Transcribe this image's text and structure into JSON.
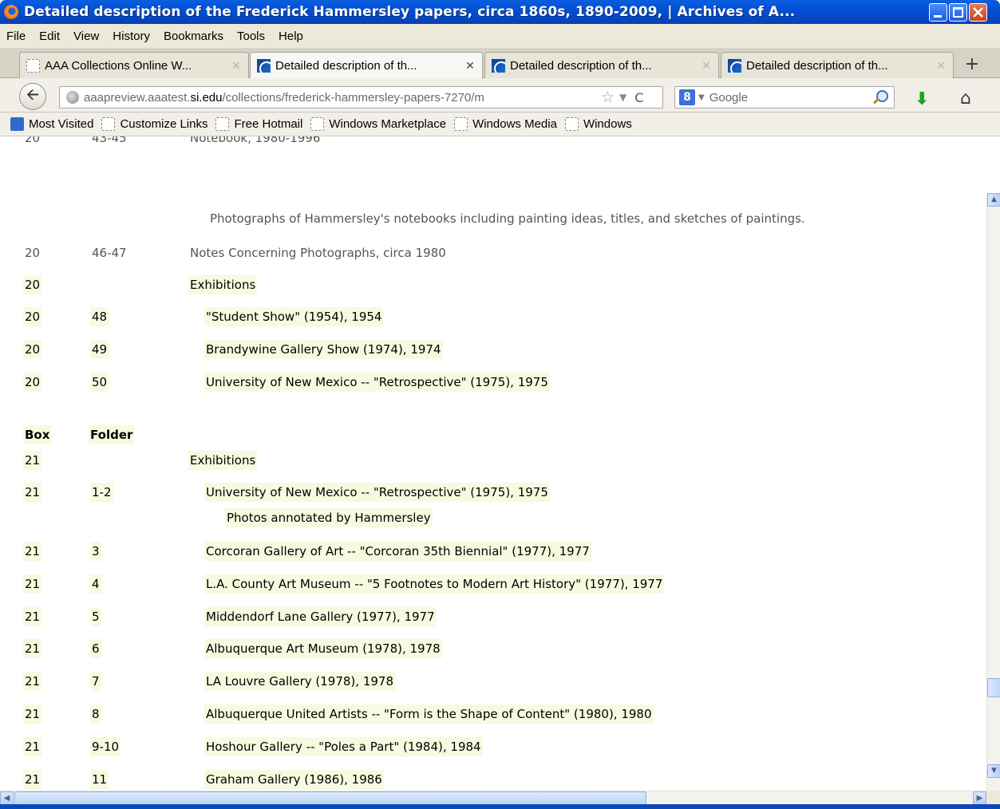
{
  "window": {
    "title": "Detailed description of the Frederick Hammersley papers, circa 1860s, 1890-2009, | Archives of A..."
  },
  "menu": [
    "File",
    "Edit",
    "View",
    "History",
    "Bookmarks",
    "Tools",
    "Help"
  ],
  "tabs": [
    {
      "label": "AAA Collections Online W...",
      "active": false,
      "icon": "blank-page-icon"
    },
    {
      "label": "Detailed description of th...",
      "active": true,
      "icon": "aaa-favicon"
    },
    {
      "label": "Detailed description of th...",
      "active": false,
      "icon": "aaa-favicon"
    },
    {
      "label": "Detailed description of th...",
      "active": false,
      "icon": "aaa-favicon"
    }
  ],
  "nav": {
    "url_prefix": "aaapreview.aaatest.",
    "url_domain": "si.edu",
    "url_path": "/collections/frederick-hammersley-papers-7270/m",
    "search_placeholder": "Google",
    "search_engine_letter": "8"
  },
  "bookmarks": [
    "Most Visited",
    "Customize Links",
    "Free Hotmail",
    "Windows Marketplace",
    "Windows Media",
    "Windows"
  ],
  "content": {
    "top_row": {
      "box": "20",
      "folder": "43-45",
      "title": "Notebook, 1980-1996"
    },
    "top_note": "Photographs of Hammersley's notebooks including painting ideas, titles, and sketches of paintings.",
    "rows_a": [
      {
        "box": "20",
        "folder": "46-47",
        "title": "Notes Concerning Photographs, circa 1980",
        "hl": false,
        "indent": false
      },
      {
        "box": "20",
        "folder": "",
        "title": "Exhibitions",
        "hl": true,
        "indent": false
      },
      {
        "box": "20",
        "folder": "48",
        "title": "\"Student Show\" (1954), 1954",
        "hl": true,
        "indent": true
      },
      {
        "box": "20",
        "folder": "49",
        "title": "Brandywine Gallery Show (1974), 1974",
        "hl": true,
        "indent": true
      },
      {
        "box": "20",
        "folder": "50",
        "title": "University of New Mexico -- \"Retrospective\" (1975), 1975",
        "hl": true,
        "indent": true
      }
    ],
    "header": {
      "box": "Box",
      "folder": "Folder"
    },
    "rows_b0": {
      "box": "21",
      "folder": "",
      "title": "Exhibitions"
    },
    "rows_b1": {
      "box": "21",
      "folder": "1-2",
      "title": "University of New Mexico -- \"Retrospective\" (1975), 1975"
    },
    "rows_b1_note": "Photos annotated by Hammersley",
    "rows_b": [
      {
        "box": "21",
        "folder": "3",
        "title": "Corcoran Gallery of Art -- \"Corcoran 35th Biennial\" (1977), 1977"
      },
      {
        "box": "21",
        "folder": "4",
        "title": "L.A. County Art Museum -- \"5 Footnotes to Modern Art History\" (1977), 1977"
      },
      {
        "box": "21",
        "folder": "5",
        "title": "Middendorf Lane Gallery (1977), 1977"
      },
      {
        "box": "21",
        "folder": "6",
        "title": "Albuquerque Art Museum (1978), 1978"
      },
      {
        "box": "21",
        "folder": "7",
        "title": "LA Louvre Gallery (1978), 1978"
      },
      {
        "box": "21",
        "folder": "8",
        "title": "Albuquerque United Artists -- \"Form is the Shape of Content\" (1980), 1980"
      },
      {
        "box": "21",
        "folder": "9-10",
        "title": "Hoshour Gallery -- \"Poles a Part\" (1984), 1984"
      },
      {
        "box": "21",
        "folder": "11",
        "title": "Graham Gallery (1986), 1986"
      }
    ]
  }
}
